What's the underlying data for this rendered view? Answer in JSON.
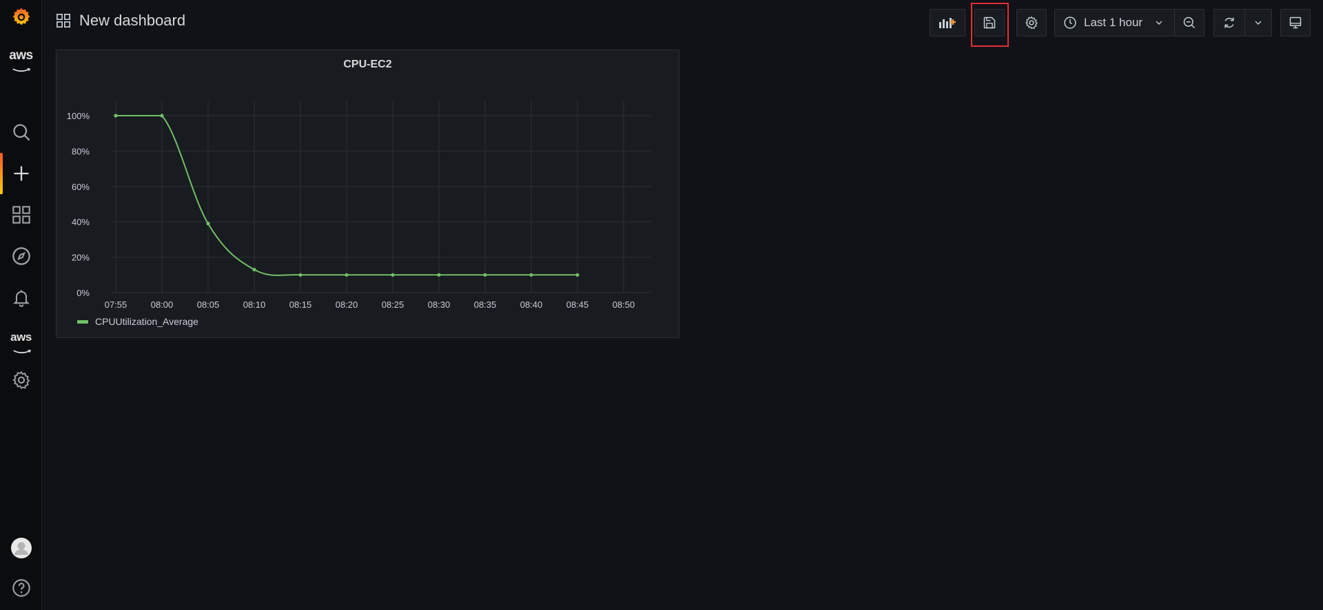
{
  "app": {
    "brand": "Grafana"
  },
  "sidebar": {
    "items": [
      {
        "name": "grafana-logo",
        "icon": "grafana-logo"
      },
      {
        "name": "aws-top",
        "icon": "aws-logo",
        "label": "aws"
      },
      {
        "name": "search",
        "icon": "search-icon"
      },
      {
        "name": "create",
        "icon": "plus-icon"
      },
      {
        "name": "dashboards",
        "icon": "dashboards-icon"
      },
      {
        "name": "explore",
        "icon": "compass-icon"
      },
      {
        "name": "alerting",
        "icon": "bell-icon"
      },
      {
        "name": "aws-mid",
        "icon": "aws-logo",
        "label": "aws"
      },
      {
        "name": "configuration",
        "icon": "gear-icon"
      },
      {
        "name": "profile",
        "icon": "avatar"
      },
      {
        "name": "help",
        "icon": "help-icon"
      }
    ]
  },
  "header": {
    "title": "New dashboard",
    "time_range": "Last 1 hour"
  },
  "colors": {
    "accent": "#f05a28",
    "series": "#73bf69",
    "highlight": "#e02f36"
  },
  "panel": {
    "title": "CPU-EC2"
  },
  "chart_data": {
    "type": "line",
    "title": "CPU-EC2",
    "x_ticks": [
      "07:55",
      "08:00",
      "08:05",
      "08:10",
      "08:15",
      "08:20",
      "08:25",
      "08:30",
      "08:35",
      "08:40",
      "08:45",
      "08:50"
    ],
    "y_ticks": [
      "0%",
      "20%",
      "40%",
      "60%",
      "80%",
      "100%"
    ],
    "ylim": [
      0,
      100
    ],
    "series": [
      {
        "name": "CPUUtilization_Average",
        "color": "#73bf69",
        "x": [
          "07:55",
          "08:00",
          "08:05",
          "08:10",
          "08:15",
          "08:20",
          "08:25",
          "08:30",
          "08:35",
          "08:40",
          "08:45"
        ],
        "values": [
          100,
          100,
          39,
          13,
          10,
          10,
          10,
          10,
          10,
          10,
          10
        ]
      }
    ],
    "legend": "bottom-left",
    "grid": true
  }
}
